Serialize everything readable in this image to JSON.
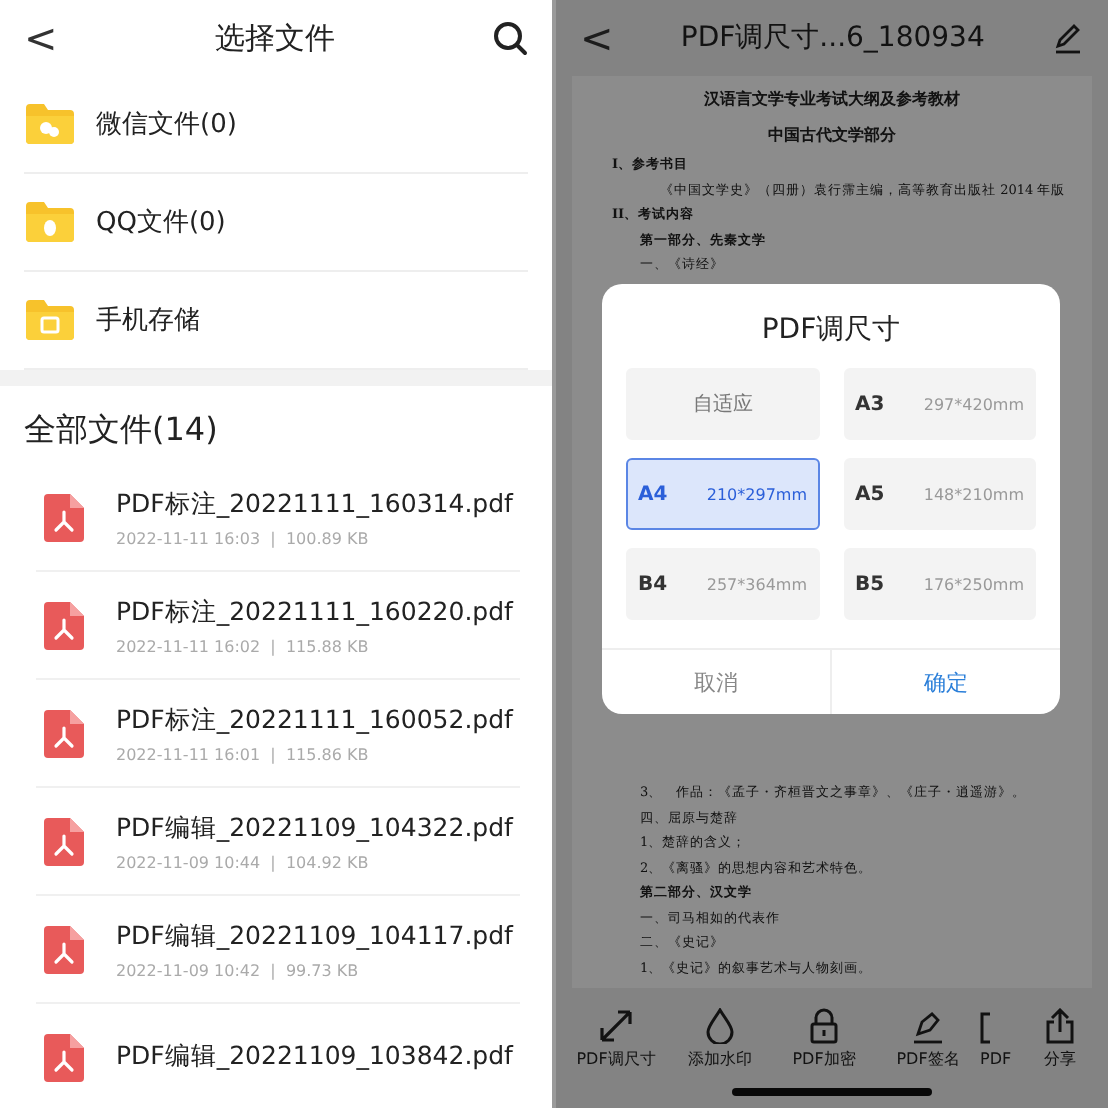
{
  "left": {
    "back": "<",
    "title": "选择文件",
    "folders": [
      {
        "label": "微信文件(0)"
      },
      {
        "label": "QQ文件(0)"
      },
      {
        "label": "手机存储"
      }
    ],
    "section_title": "全部文件(14)",
    "files": [
      {
        "name": "PDF标注_20221111_160314.pdf",
        "meta": "2022-11-11 16:03  |  100.89 KB"
      },
      {
        "name": "PDF标注_20221111_160220.pdf",
        "meta": "2022-11-11 16:02  |  115.88 KB"
      },
      {
        "name": "PDF标注_20221111_160052.pdf",
        "meta": "2022-11-11 16:01  |  115.86 KB"
      },
      {
        "name": "PDF编辑_20221109_104322.pdf",
        "meta": "2022-11-09 10:44  |  104.92 KB"
      },
      {
        "name": "PDF编辑_20221109_104117.pdf",
        "meta": "2022-11-09 10:42  |  99.73 KB"
      },
      {
        "name": "PDF编辑_20221109_103842.pdf"
      }
    ]
  },
  "right": {
    "back": "<",
    "title": "PDF调尺寸...6_180934",
    "document": {
      "top_lines": [
        {
          "text": "汉语言文学专业考试大纲及参考教材",
          "kind": "title"
        },
        {
          "text": "中国古代文学部分",
          "kind": "title"
        },
        {
          "text": "I、参考书目",
          "kind": "heading"
        },
        {
          "text": "《中国文学史》（四册）袁行霈主编，高等教育出版社 2014 年版",
          "kind": "indent"
        },
        {
          "text": "II、考试内容",
          "kind": "heading"
        },
        {
          "text": "第一部分、先秦文学",
          "kind": "bold"
        },
        {
          "text": "一、《诗经》",
          "kind": "normal"
        }
      ],
      "bottom_lines": [
        {
          "text": "3、　作品：《孟子・齐桓晋文之事章》、《庄子・逍遥游》。",
          "kind": "normal"
        },
        {
          "text": "四、屈原与楚辞",
          "kind": "normal"
        },
        {
          "text": "1、楚辞的含义；",
          "kind": "normal"
        },
        {
          "text": "2、《离骚》的思想内容和艺术特色。",
          "kind": "normal"
        },
        {
          "text": "第二部分、汉文学",
          "kind": "bold"
        },
        {
          "text": "一、司马相如的代表作",
          "kind": "normal"
        },
        {
          "text": "二、《史记》",
          "kind": "normal"
        },
        {
          "text": "1、《史记》的叙事艺术与人物刻画。",
          "kind": "normal"
        }
      ]
    },
    "toolbar": [
      {
        "label": "PDF调尺寸"
      },
      {
        "label": "添加水印"
      },
      {
        "label": "PDF加密"
      },
      {
        "label": "PDF签名"
      },
      {
        "label": "PDF"
      },
      {
        "label": "分享"
      }
    ],
    "dialog": {
      "title": "PDF调尺寸",
      "options": [
        {
          "label": "自适应",
          "selected": false
        },
        {
          "label": "A3",
          "dims": "297*420mm",
          "selected": false
        },
        {
          "label": "A4",
          "dims": "210*297mm",
          "selected": true
        },
        {
          "label": "A5",
          "dims": "148*210mm",
          "selected": false
        },
        {
          "label": "B4",
          "dims": "257*364mm",
          "selected": false
        },
        {
          "label": "B5",
          "dims": "176*250mm",
          "selected": false
        }
      ],
      "cancel": "取消",
      "confirm": "确定"
    }
  }
}
